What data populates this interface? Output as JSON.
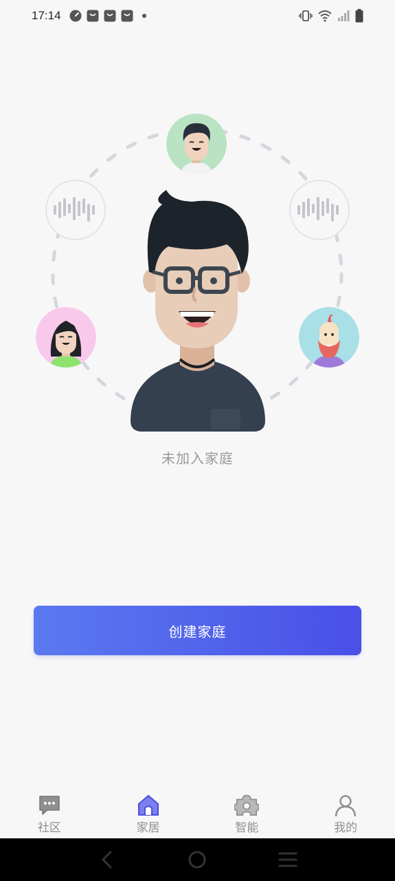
{
  "status_bar": {
    "time": "17:14",
    "left_icons": [
      "speedometer-icon",
      "shopping-bag-icon",
      "shopping-bag-icon",
      "shopping-bag-icon",
      "notification-dot-icon"
    ],
    "right_icons": [
      "vibrate-icon",
      "wifi-icon",
      "cell-signal-icon",
      "battery-icon"
    ]
  },
  "main": {
    "status_text": "未加入家庭",
    "create_button_label": "创建家庭"
  },
  "tabs": [
    {
      "label": "社区",
      "icon": "chat-bubble-icon",
      "active": false
    },
    {
      "label": "家居",
      "icon": "home-icon",
      "active": true
    },
    {
      "label": "智能",
      "icon": "puzzle-icon",
      "active": false
    },
    {
      "label": "我的",
      "icon": "person-icon",
      "active": false
    }
  ],
  "nav_bar": {
    "buttons": [
      "back-icon",
      "home-circle-icon",
      "menu-icon"
    ]
  },
  "colors": {
    "accent_start": "#5a7af0",
    "accent_end": "#4a4fe8",
    "active_tab_icon": "#5b5fe0",
    "inactive_tab_icon": "#8f8f8f",
    "background": "#f7f7f8"
  }
}
